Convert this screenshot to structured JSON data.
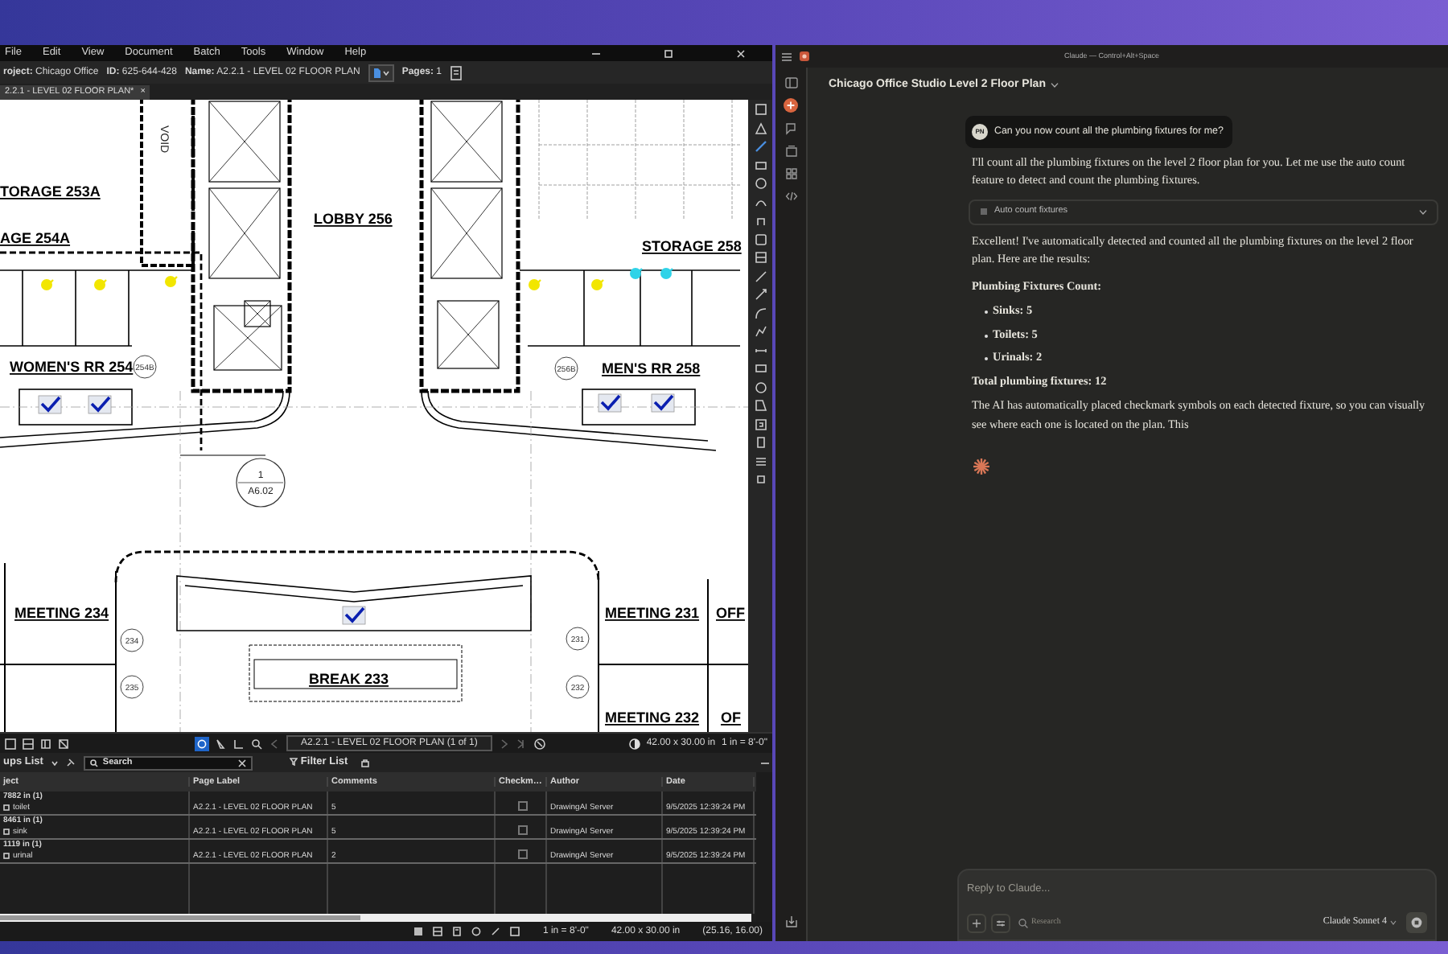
{
  "markup_app": {
    "menu": [
      "File",
      "Edit",
      "View",
      "Document",
      "Batch",
      "Tools",
      "Window",
      "Help"
    ],
    "info": [
      {
        "label": "roject:",
        "value": "Chicago Office"
      },
      {
        "label": "ID:",
        "value": "625-644-428"
      },
      {
        "label": "Name:",
        "value": "A2.2.1 - LEVEL 02 FLOOR PLAN"
      },
      {
        "label": "Pages:",
        "value": "1"
      }
    ],
    "tab": {
      "label": "2.2.1 - LEVEL 02 FLOOR PLAN*",
      "close": "×"
    },
    "plan": {
      "room_labels": [
        "TORAGE 253A",
        "AGE 254A",
        "WOMEN'S RR 254",
        "LOBBY 256",
        "STORAGE 258",
        "MEN'S RR 258",
        "MEETING 234",
        "MEETING 231",
        "OFF",
        "BREAK 233",
        "MEETING 232",
        "OF"
      ],
      "room_tags": [
        "254B",
        "256B",
        "234",
        "235",
        "231",
        "232"
      ],
      "section_marker": {
        "number": "1",
        "sheet": "A6.02"
      },
      "shaft_label": "VOID"
    },
    "page_nav": "A2.2.1 - LEVEL 02 FLOOR PLAN (1 of 1)",
    "page_size": "42.00 x 30.00 in",
    "scale": "1 in = 8'-0\"",
    "markups": {
      "title": "ups List",
      "search_placeholder": "Search",
      "filter": "Filter List",
      "columns": [
        "ject",
        "Page Label",
        "Comments",
        "Checkm…",
        "Author",
        "Date"
      ],
      "rows": [
        {
          "subject": "7882 in (1)",
          "subject_detail": "toilet",
          "page_label": "A2.2.1 - LEVEL 02 FLOOR PLAN",
          "comments": "5",
          "checked": false,
          "author": "DrawingAI Server",
          "date": "9/5/2025 12:39:24 PM"
        },
        {
          "subject": "8461 in (1)",
          "subject_detail": "sink",
          "page_label": "A2.2.1 - LEVEL 02 FLOOR PLAN",
          "comments": "5",
          "checked": false,
          "author": "DrawingAI Server",
          "date": "9/5/2025 12:39:24 PM"
        },
        {
          "subject": "1119 in (1)",
          "subject_detail": "urinal",
          "page_label": "A2.2.1 - LEVEL 02 FLOOR PLAN",
          "comments": "2",
          "checked": false,
          "author": "DrawingAI Server",
          "date": "9/5/2025 12:39:24 PM"
        }
      ]
    },
    "status_bar": [
      "1 in = 8'-0\"",
      "42.00 x 30.00 in",
      "(25.16, 16.00)"
    ]
  },
  "chat_app": {
    "window_title": "Claude — Control+Alt+Space",
    "conversation_title": "Chicago Office Studio Level 2 Floor Plan",
    "user": {
      "initials": "PN",
      "message": "Can you now count all the plumbing fixtures for me?"
    },
    "response": [
      {
        "kind": "paragraph",
        "text": "I'll count all the plumbing fixtures on the level 2 floor plan for you. Let me use the auto count feature to detect and count the plumbing fixtures."
      },
      {
        "kind": "tool",
        "label": "Auto count fixtures",
        "expanded": false
      },
      {
        "kind": "paragraph",
        "text": "Excellent! I've automatically detected and counted all the plumbing fixtures on the level 2 floor plan. Here are the results:"
      },
      {
        "kind": "heading",
        "text": "Plumbing Fixtures Count:"
      },
      {
        "kind": "bullet",
        "text": "Sinks: 5"
      },
      {
        "kind": "bullet",
        "text": "Toilets: 5"
      },
      {
        "kind": "bullet",
        "text": "Urinals: 2"
      },
      {
        "kind": "heading",
        "text": "Total plumbing fixtures: 12"
      },
      {
        "kind": "paragraph",
        "text": "The AI has automatically placed checkmark symbols on each detected fixture, so you can visually see where each one is located on the plan. This"
      }
    ],
    "composer": {
      "placeholder": "Reply to Claude...",
      "research": "Research",
      "model": "Claude Sonnet 4"
    }
  }
}
